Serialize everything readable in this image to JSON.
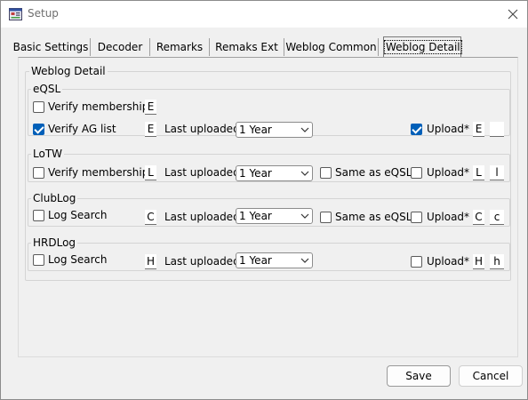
{
  "window": {
    "title": "Setup"
  },
  "tabs": [
    "Basic Settings",
    "Decoder",
    "Remarks",
    "Remaks Ext",
    "Weblog Common",
    "Weblog Detail"
  ],
  "active_tab": "Weblog Detail",
  "panel": {
    "group_title": "Weblog Detail",
    "eqsl": {
      "title": "eQSL",
      "verify_membership": {
        "label": "Verify membership",
        "checked": false,
        "key": "E"
      },
      "verify_ag_list": {
        "label": "Verify AG list",
        "checked": true,
        "key": "E"
      },
      "last_uploaded_label": "Last uploaded",
      "last_uploaded_value": "1 Year",
      "upload": {
        "label": "Upload",
        "checked": true,
        "star": "*",
        "key1": "E",
        "key2": ""
      }
    },
    "lotw": {
      "title": "LoTW",
      "verify_membership": {
        "label": "Verify membership",
        "checked": false,
        "key": "L"
      },
      "last_uploaded_label": "Last uploaded",
      "last_uploaded_value": "1 Year",
      "same_as_eqsl": {
        "label": "Same as eQSL",
        "checked": false
      },
      "upload": {
        "label": "Upload",
        "checked": false,
        "star": "*",
        "key1": "L",
        "key2": "l"
      }
    },
    "clublog": {
      "title": "ClubLog",
      "log_search": {
        "label": "Log Search",
        "checked": false,
        "key": "C"
      },
      "last_uploaded_label": "Last uploaded",
      "last_uploaded_value": "1 Year",
      "same_as_eqsl": {
        "label": "Same as eQSL",
        "checked": false
      },
      "upload": {
        "label": "Upload",
        "checked": false,
        "star": "*",
        "key1": "C",
        "key2": "c"
      }
    },
    "hrdlog": {
      "title": "HRDLog",
      "log_search": {
        "label": "Log Search",
        "checked": false,
        "key": "H"
      },
      "last_uploaded_label": "Last uploaded",
      "last_uploaded_value": "1 Year",
      "upload": {
        "label": "Upload",
        "checked": false,
        "star": "*",
        "key1": "H",
        "key2": "h"
      }
    }
  },
  "buttons": {
    "save": "Save",
    "cancel": "Cancel"
  },
  "colors": {
    "accent": "#005fb8",
    "window_bg": "#f0f0f0",
    "title_text": "#6e6e6e"
  }
}
